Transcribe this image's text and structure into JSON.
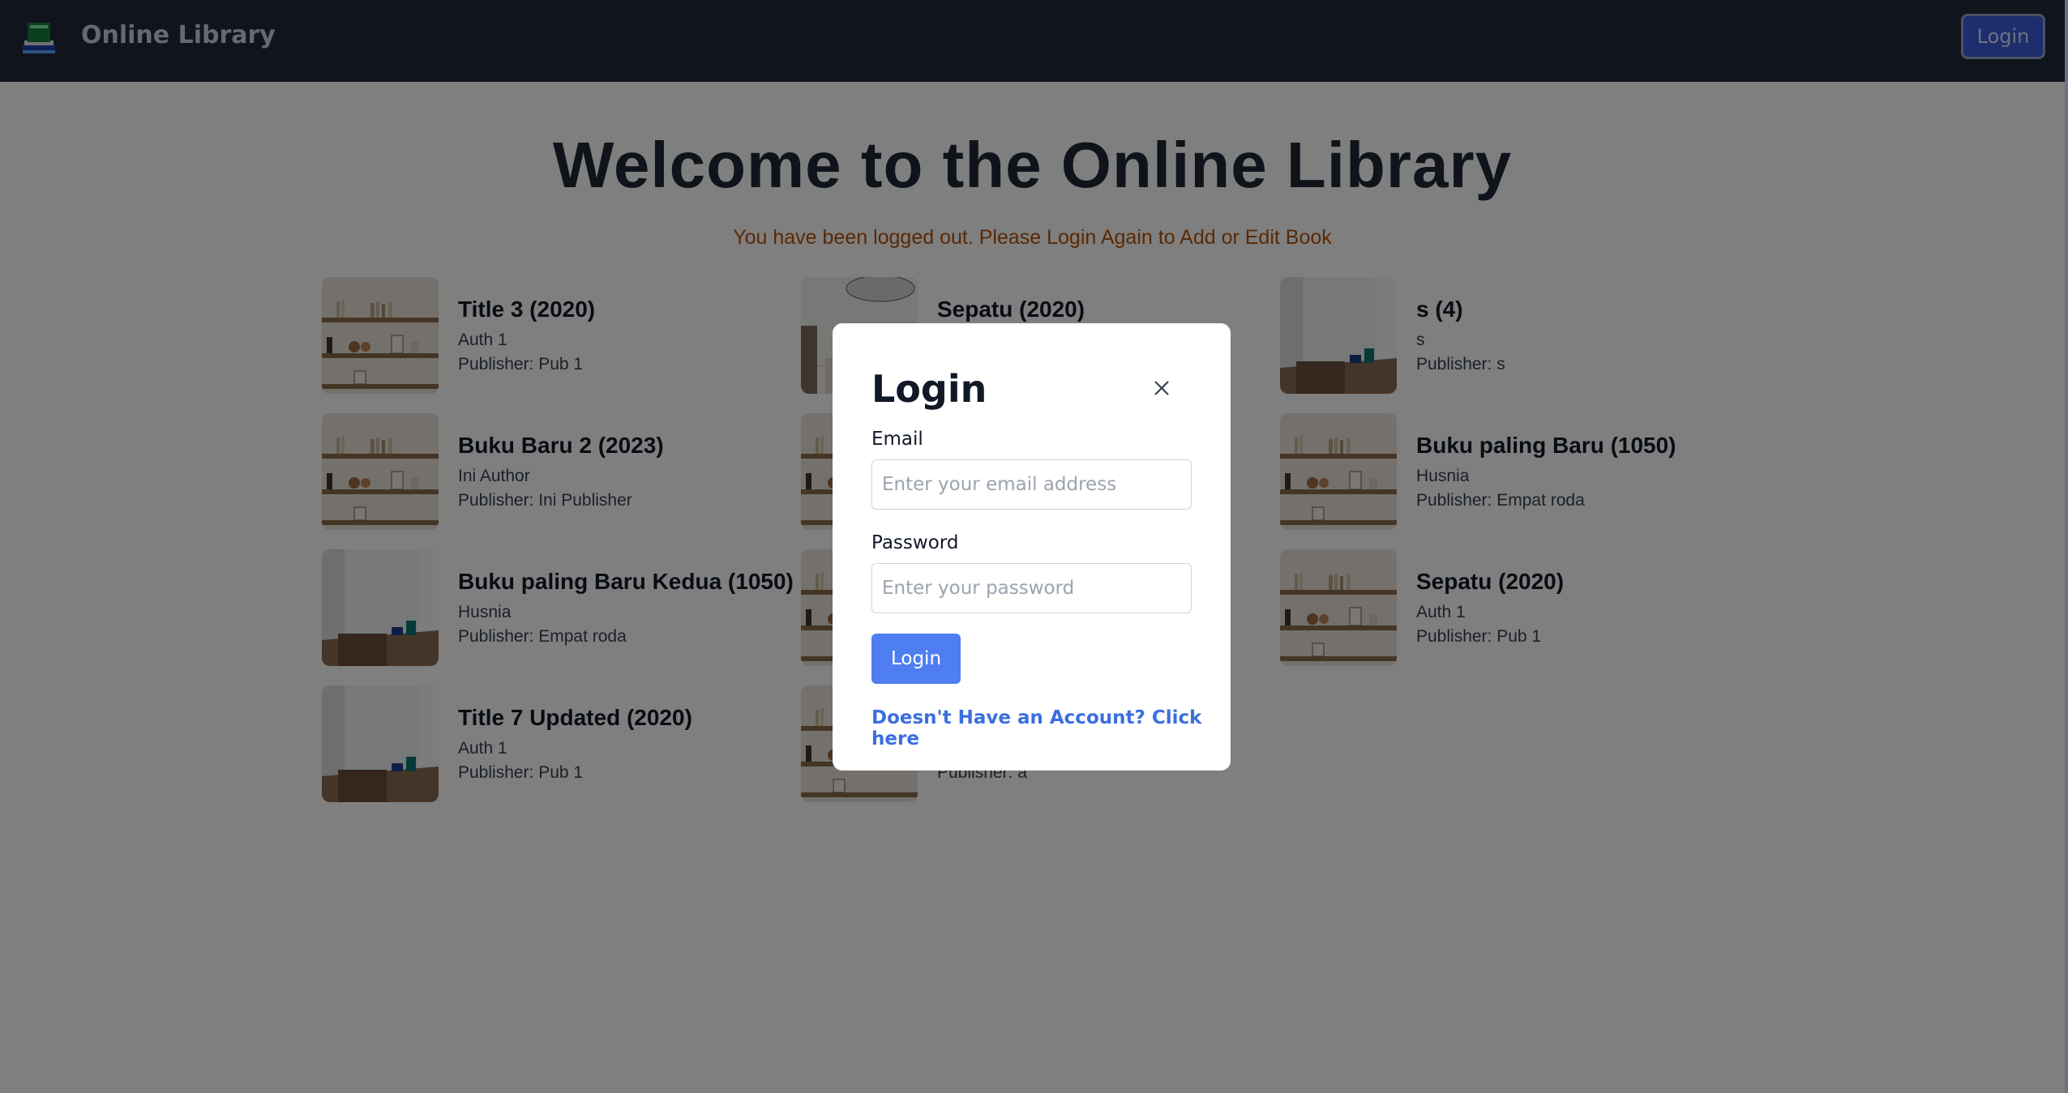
{
  "navbar": {
    "brand": "Online Library",
    "login_label": "Login",
    "logo_icon": "library-book-logo-icon"
  },
  "main": {
    "welcome": "Welcome to the Online Library",
    "logout_message": "You have been logged out. Please Login Again to Add or Edit Book"
  },
  "books": [
    {
      "title": "Title 3 (2020)",
      "author": "Auth 1",
      "publisher": "Publisher: Pub 1",
      "cover": "shelf"
    },
    {
      "title": "Sepatu (2020)",
      "author": "",
      "publisher": "",
      "cover": "room"
    },
    {
      "title": "s (4)",
      "author": "s",
      "publisher": "Publisher: s",
      "cover": "desk"
    },
    {
      "title": "Buku Baru 2 (2023)",
      "author": "Ini Author",
      "publisher": "Publisher: Ini Publisher",
      "cover": "shelf"
    },
    {
      "title": "",
      "author": "",
      "publisher": "",
      "cover": "shelf"
    },
    {
      "title": "Buku paling Baru (1050)",
      "author": "Husnia",
      "publisher": "Publisher: Empat roda",
      "cover": "shelf"
    },
    {
      "title": "Buku paling Baru Kedua (1050)",
      "author": "Husnia",
      "publisher": "Publisher: Empat roda",
      "cover": "desk"
    },
    {
      "title": ")",
      "author": "",
      "publisher": "",
      "cover": "shelf"
    },
    {
      "title": "Sepatu (2020)",
      "author": "Auth 1",
      "publisher": "Publisher: Pub 1",
      "cover": "shelf"
    },
    {
      "title": "Title 7 Updated (2020)",
      "author": "Auth 1",
      "publisher": "Publisher: Pub 1",
      "cover": "desk"
    },
    {
      "title": "",
      "author": "",
      "publisher": "Publisher: a",
      "cover": "shelf"
    }
  ],
  "modal": {
    "title": "Login",
    "close_icon": "close-icon",
    "email_label": "Email",
    "email_placeholder": "Enter your email address",
    "email_value": "",
    "password_label": "Password",
    "password_placeholder": "Enter your password",
    "password_value": "",
    "login_label": "Login",
    "register_link": "Doesn't Have an Account? Click here"
  },
  "colors": {
    "navbar_bg": "#1e293b",
    "primary": "#4f7ef0",
    "warning_text": "#b45309",
    "overlay": "rgba(0,0,0,0.5)"
  }
}
